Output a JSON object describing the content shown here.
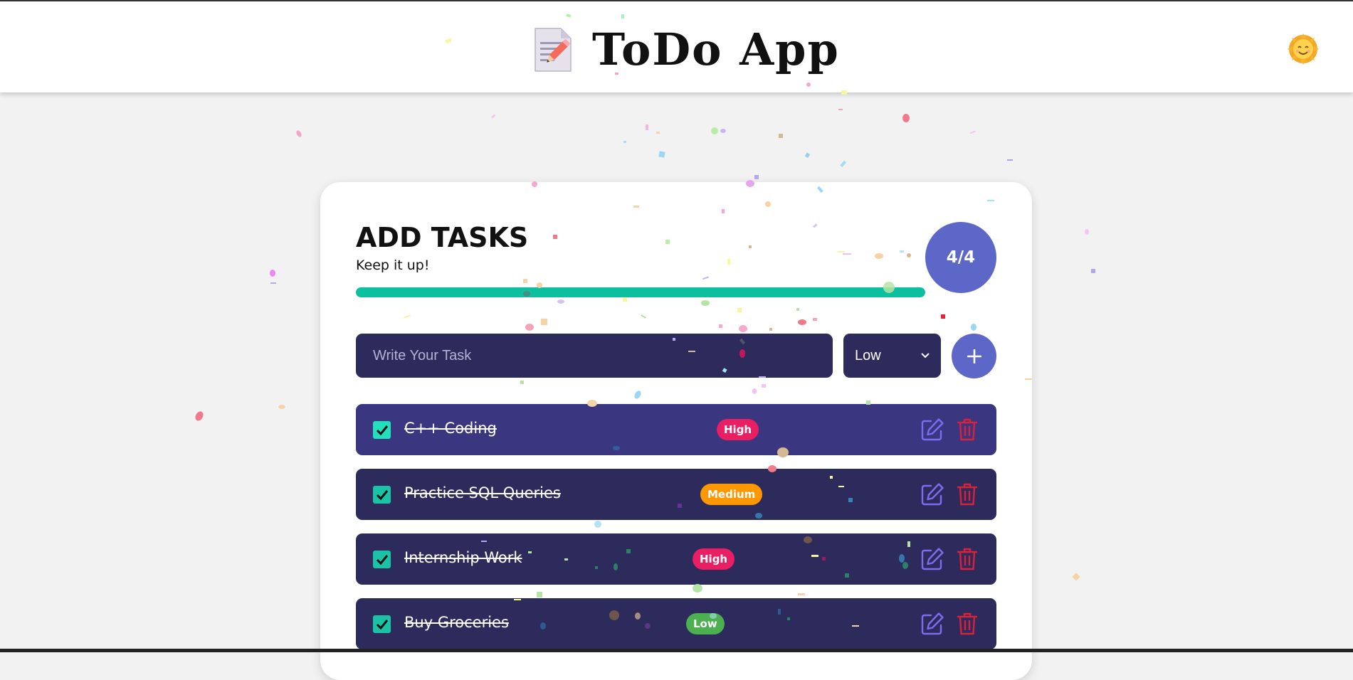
{
  "header": {
    "logo_icon": "memo-pencil-icon",
    "title": "ToDo App",
    "theme_icon": "smiling-sun-icon"
  },
  "card": {
    "title": "ADD TASKS",
    "subtitle": "Keep it up!",
    "progress": {
      "completed": 4,
      "total": 4,
      "fraction": 1.0,
      "label": "4/4"
    }
  },
  "form": {
    "placeholder": "Write Your Task",
    "value": "",
    "priority_selected": "Low",
    "add_icon": "plus-icon"
  },
  "tasks": [
    {
      "name": "C++ Coding",
      "priority": "High",
      "completed": true
    },
    {
      "name": "Practice SQL Queries",
      "priority": "Medium",
      "completed": true
    },
    {
      "name": "Internship Work",
      "priority": "High",
      "completed": true
    },
    {
      "name": "Buy Groceries",
      "priority": "Low",
      "completed": true
    }
  ],
  "colors": {
    "page_bg": "#f2f2f2",
    "card_bg": "#ffffff",
    "accent": "#5c67c8",
    "input_bg": "#2d2b5c",
    "row_bg": "#2d2b5c",
    "row_highlight": "#3b3680",
    "progress": "#0bbf9f",
    "priority_high": "#e91e63",
    "priority_medium": "#ff9800",
    "priority_low": "#4caf50",
    "edit_icon": "#7b6cf0",
    "delete_icon": "#d8213b"
  },
  "icons": {
    "check": "checkmark-icon",
    "edit": "edit-pencil-square-icon",
    "delete": "trash-icon",
    "select_arrow": "chevron-down-icon"
  }
}
